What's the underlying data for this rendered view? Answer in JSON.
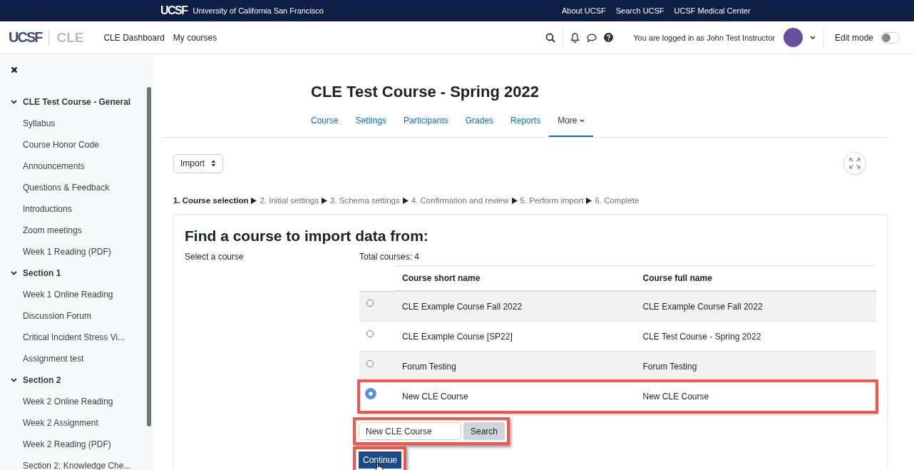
{
  "top_bar": {
    "logo": "UCSF",
    "title": "University of California San Francisco",
    "links": [
      "About UCSF",
      "Search UCSF",
      "UCSF Medical Center"
    ]
  },
  "header": {
    "logo": "UCSF",
    "product": "CLE",
    "nav": [
      "CLE Dashboard",
      "My courses"
    ],
    "user_text": "You are logged in as John Test Instructor",
    "edit_mode": {
      "label": "Edit mode",
      "on": false
    }
  },
  "sidebar": {
    "sections": [
      {
        "title": "CLE Test Course - General",
        "expanded": true,
        "children": [
          {
            "title": "Syllabus"
          },
          {
            "title": "Course Honor Code"
          },
          {
            "title": "Announcements"
          },
          {
            "title": "Questions & Feedback"
          },
          {
            "title": "Introductions"
          },
          {
            "title": "Zoom meetings"
          },
          {
            "title": "Week 1 Reading (PDF)"
          }
        ]
      },
      {
        "title": "Section 1",
        "expanded": true,
        "children": [
          {
            "title": "Week 1 Online Reading"
          },
          {
            "title": "Discussion Forum"
          },
          {
            "title": "Critical Incident Stress Vi..."
          },
          {
            "title": "Assignment test"
          }
        ]
      },
      {
        "title": "Section 2",
        "expanded": true,
        "children": [
          {
            "title": "Week 2 Online Reading"
          },
          {
            "title": "Week 2 Assignment"
          },
          {
            "title": "Week 2 Reading (PDF)"
          },
          {
            "title": "Section 2: Knowledge Che..."
          }
        ]
      }
    ]
  },
  "page": {
    "title": "CLE Test Course - Spring 2022",
    "tabs": [
      {
        "label": "Course",
        "selected": false
      },
      {
        "label": "Settings",
        "selected": false
      },
      {
        "label": "Participants",
        "selected": false
      },
      {
        "label": "Grades",
        "selected": false
      },
      {
        "label": "Reports",
        "selected": false
      },
      {
        "label": "More",
        "selected": true,
        "kind": "dropdown"
      }
    ],
    "select": {
      "value": "Import"
    },
    "steps": [
      {
        "label": "1. Course selection",
        "current": true
      },
      {
        "label": "2. Initial settings",
        "current": false
      },
      {
        "label": "3. Schema settings",
        "current": false
      },
      {
        "label": "4. Confirmation and review",
        "current": false
      },
      {
        "label": "5. Perform import",
        "current": false
      },
      {
        "label": "6. Complete",
        "current": false
      }
    ],
    "form": {
      "heading": "Find a course to import data from:",
      "field_label": "Select a course",
      "total": "Total courses: 4",
      "table": {
        "columns": [
          "Course short name",
          "Course full name"
        ],
        "rows": [
          {
            "short": "CLE Example Course Fall 2022",
            "full": "CLE Example Course Fall 2022",
            "selected": false,
            "highlighted": false
          },
          {
            "short": "CLE Example Course [SP22]",
            "full": "CLE Test Course - Spring 2022",
            "selected": false,
            "highlighted": false
          },
          {
            "short": "Forum Testing",
            "full": "Forum Testing",
            "selected": false,
            "highlighted": false
          },
          {
            "short": "New CLE Course",
            "full": "New CLE Course",
            "selected": true,
            "highlighted": true
          }
        ]
      },
      "search": {
        "value": "New CLE Course",
        "button": "Search",
        "highlighted": true
      },
      "continue": {
        "label": "Continue",
        "highlighted": true
      }
    }
  }
}
